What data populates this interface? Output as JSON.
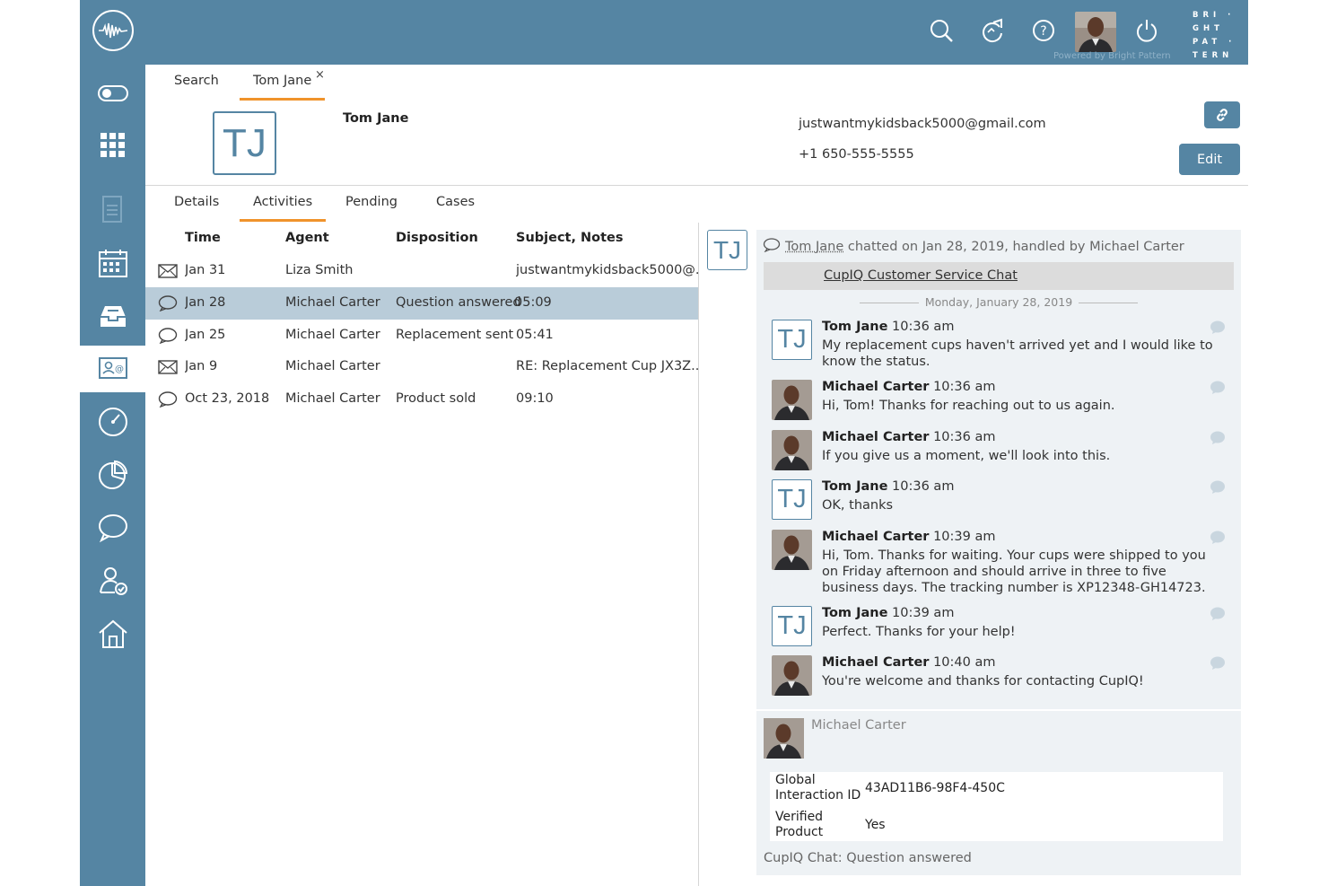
{
  "top_tabs": [
    {
      "label": "Search"
    },
    {
      "label": "Tom Jane"
    }
  ],
  "tab_close_glyph": "×",
  "top_bar": {
    "powered_by": "Powered by Bright Pattern",
    "brand": "BRI · GHT PAT · TERN"
  },
  "contact": {
    "initials": "TJ",
    "name": "Tom Jane",
    "email": "justwantmykidsback5000@gmail.com",
    "phone": "+1 650-555-5555",
    "edit_label": "Edit"
  },
  "sub_tabs": [
    {
      "label": "Details"
    },
    {
      "label": "Activities"
    },
    {
      "label": "Pending"
    },
    {
      "label": "Cases"
    }
  ],
  "table": {
    "headers": [
      "Time",
      "Agent",
      "Disposition",
      "Subject, Notes"
    ],
    "rows": [
      {
        "icon": "email-icon",
        "time": "Jan 31",
        "agent": "Liza Smith",
        "disposition": "",
        "notes": "justwantmykidsback5000@..."
      },
      {
        "icon": "chat-icon",
        "time": "Jan 28",
        "agent": "Michael Carter",
        "disposition": "Question answered",
        "notes": "05:09"
      },
      {
        "icon": "chat-icon",
        "time": "Jan 25",
        "agent": "Michael Carter",
        "disposition": "Replacement sent",
        "notes": "05:41"
      },
      {
        "icon": "email-icon",
        "time": "Jan 9",
        "agent": "Michael Carter",
        "disposition": "",
        "notes": "RE: Replacement Cup JX3Z..."
      },
      {
        "icon": "chat-icon",
        "time": "Oct 23, 2018",
        "agent": "Michael Carter",
        "disposition": "Product sold",
        "notes": "09:10"
      }
    ]
  },
  "chat": {
    "summary_name": "Tom Jane",
    "summary_rest": " chatted on Jan 28, 2019, handled by Michael Carter",
    "title": "CupIQ Customer Service Chat",
    "date": "Monday, January 28, 2019",
    "messages": [
      {
        "author": "Tom Jane",
        "time": "10:36 am",
        "text": "My replacement cups haven't arrived yet and I would like to know the status.",
        "avatar": "TJ"
      },
      {
        "author": "Michael Carter",
        "time": "10:36 am",
        "text": "Hi, Tom! Thanks for reaching out to us again.",
        "avatar": "photo"
      },
      {
        "author": "Michael Carter",
        "time": "10:36 am",
        "text": "If you give us a moment, we'll look into this.",
        "avatar": "photo"
      },
      {
        "author": "Tom Jane",
        "time": "10:36 am",
        "text": "OK, thanks",
        "avatar": "TJ"
      },
      {
        "author": "Michael Carter",
        "time": "10:39 am",
        "text": "Hi, Tom. Thanks for waiting. Your cups were shipped to you on Friday afternoon and should arrive in three to five business days. The tracking number is XP12348-GH14723.",
        "avatar": "photo"
      },
      {
        "author": "Tom Jane",
        "time": "10:39 am",
        "text": "Perfect. Thanks for your help!",
        "avatar": "TJ"
      },
      {
        "author": "Michael Carter",
        "time": "10:40 am",
        "text": "You're welcome and thanks for contacting CupIQ!",
        "avatar": "photo"
      }
    ],
    "agent_name": "Michael Carter",
    "properties": [
      {
        "key": "Global Interaction ID",
        "value": "43AD11B6-98F4-450C"
      },
      {
        "key": "Verified Product",
        "value": "Yes"
      }
    ],
    "disposition_text": "CupIQ Chat: Question answered"
  },
  "colors": {
    "brand_blue": "#5585a3",
    "tab_accent": "#f0932b",
    "selected_row": "#b9ccd9"
  }
}
